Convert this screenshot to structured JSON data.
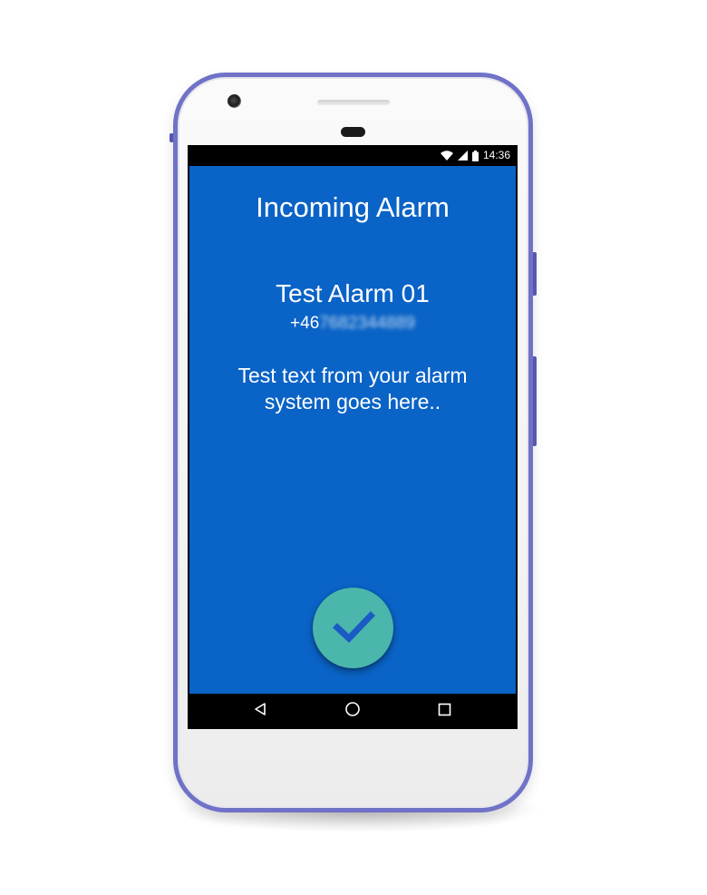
{
  "status_bar": {
    "time": "14:36",
    "icons": [
      "wifi-icon",
      "signal-icon",
      "battery-icon"
    ]
  },
  "alarm_screen": {
    "title": "Incoming Alarm",
    "alarm_name": "Test Alarm 01",
    "phone_prefix": "+46",
    "phone_obscured": "7682344889",
    "message": "Test text from your alarm system goes here..",
    "acknowledge_icon": "checkmark-icon"
  },
  "nav_bar": {
    "items": [
      "back-icon",
      "home-icon",
      "recents-icon"
    ]
  },
  "colors": {
    "app_background": "#0a63c6",
    "acknowledge_button": "#4bb6ab",
    "checkmark": "#1a5bc4",
    "device_frame": "#6f72c6"
  }
}
